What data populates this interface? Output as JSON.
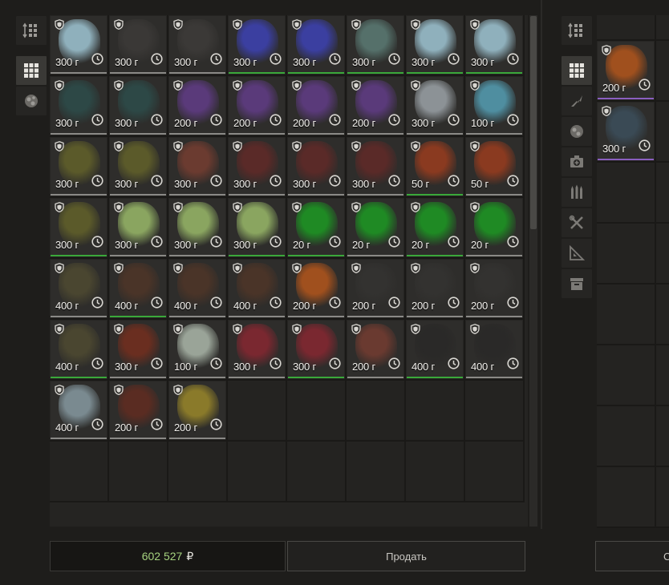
{
  "left_inventory": {
    "columns": 8,
    "rows": 8,
    "items": [
      {
        "price": "300 г",
        "tier": "common",
        "color": "#8fb0bc"
      },
      {
        "price": "300 г",
        "tier": "common",
        "color": "#3a3836"
      },
      {
        "price": "300 г",
        "tier": "common",
        "color": "#3b3937"
      },
      {
        "price": "300 г",
        "tier": "rare",
        "color": "#3b3fa0"
      },
      {
        "price": "300 г",
        "tier": "rare",
        "color": "#3b3fa0"
      },
      {
        "price": "300 г",
        "tier": "rare",
        "color": "#55706a"
      },
      {
        "price": "300 г",
        "tier": "rare",
        "color": "#8fb0bc"
      },
      {
        "price": "300 г",
        "tier": "rare",
        "color": "#8fb0bc"
      },
      {
        "price": "300 г",
        "tier": "common",
        "color": "#2d4846"
      },
      {
        "price": "300 г",
        "tier": "common",
        "color": "#2d4846"
      },
      {
        "price": "200 г",
        "tier": "common",
        "color": "#5a3a7a"
      },
      {
        "price": "200 г",
        "tier": "common",
        "color": "#5a3a7a"
      },
      {
        "price": "200 г",
        "tier": "common",
        "color": "#5a3a7a"
      },
      {
        "price": "200 г",
        "tier": "common",
        "color": "#5a3a7a"
      },
      {
        "price": "300 г",
        "tier": "common",
        "color": "#8c9296"
      },
      {
        "price": "100 г",
        "tier": "common",
        "color": "#4f8ea0"
      },
      {
        "price": "300 г",
        "tier": "common",
        "color": "#5b5a2a"
      },
      {
        "price": "300 г",
        "tier": "common",
        "color": "#5b5a2a"
      },
      {
        "price": "300 г",
        "tier": "common",
        "color": "#6b3b30"
      },
      {
        "price": "300 г",
        "tier": "common",
        "color": "#5a2a28"
      },
      {
        "price": "300 г",
        "tier": "common",
        "color": "#5a2a28"
      },
      {
        "price": "300 г",
        "tier": "common",
        "color": "#5a2a28"
      },
      {
        "price": "50 г",
        "tier": "rare",
        "color": "#8a3a20"
      },
      {
        "price": "50 г",
        "tier": "common",
        "color": "#8a3a20"
      },
      {
        "price": "300 г",
        "tier": "rare",
        "color": "#5b5a2a"
      },
      {
        "price": "300 г",
        "tier": "common",
        "color": "#8aa560"
      },
      {
        "price": "300 г",
        "tier": "common",
        "color": "#8aa560"
      },
      {
        "price": "300 г",
        "tier": "rare",
        "color": "#8aa560"
      },
      {
        "price": "20 г",
        "tier": "rare",
        "color": "#1f8a24"
      },
      {
        "price": "20 г",
        "tier": "common",
        "color": "#1f8a24"
      },
      {
        "price": "20 г",
        "tier": "rare",
        "color": "#1f8a24"
      },
      {
        "price": "20 г",
        "tier": "common",
        "color": "#1f8a24"
      },
      {
        "price": "400 г",
        "tier": "common",
        "color": "#4a4630"
      },
      {
        "price": "400 г",
        "tier": "rare",
        "color": "#4a3428"
      },
      {
        "price": "400 г",
        "tier": "common",
        "color": "#4a3428"
      },
      {
        "price": "400 г",
        "tier": "common",
        "color": "#4a3428"
      },
      {
        "price": "200 г",
        "tier": "common",
        "color": "#a0501e"
      },
      {
        "price": "200 г",
        "tier": "common",
        "color": "#333230"
      },
      {
        "price": "200 г",
        "tier": "common",
        "color": "#333230"
      },
      {
        "price": "200 г",
        "tier": "common",
        "color": "#333230"
      },
      {
        "price": "400 г",
        "tier": "rare",
        "color": "#4a4630"
      },
      {
        "price": "300 г",
        "tier": "common",
        "color": "#6a2e20"
      },
      {
        "price": "100 г",
        "tier": "common",
        "color": "#9aa498"
      },
      {
        "price": "300 г",
        "tier": "common",
        "color": "#7a2830"
      },
      {
        "price": "300 г",
        "tier": "rare",
        "color": "#7a2830"
      },
      {
        "price": "200 г",
        "tier": "common",
        "color": "#6a3a30"
      },
      {
        "price": "400 г",
        "tier": "rare",
        "color": "#2a2928"
      },
      {
        "price": "400 г",
        "tier": "common",
        "color": "#2a2928"
      },
      {
        "price": "400 г",
        "tier": "common",
        "color": "#7a8a90"
      },
      {
        "price": "200 г",
        "tier": "common",
        "color": "#5a2c22"
      },
      {
        "price": "200 г",
        "tier": "common",
        "color": "#8a7a2a"
      }
    ]
  },
  "right_inventory": {
    "items": [
      {
        "price": "200 г",
        "tier": "epic",
        "color": "#a0501e"
      },
      {
        "price": "300 г",
        "tier": "epic",
        "color": "#3a4a55"
      }
    ]
  },
  "footer": {
    "money_value": "602 527",
    "currency_symbol": "₽",
    "sell_label": "Продать",
    "right_button_label": "С"
  }
}
